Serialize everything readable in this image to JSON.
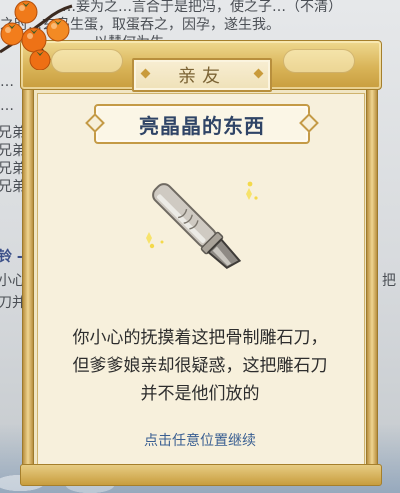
{
  "background": {
    "lines": [
      "…妾为之…言合于是把冯，使之子…（不清）",
      "之时…玄鸟生蛋，取蛋吞之，因孕，遂生我。",
      "…以慧何为生",
      "…",
      "…",
      "兄弟",
      "兄弟",
      "兄弟",
      "兄弟",
      "铃 -",
      "小心",
      "刀并"
    ],
    "right_fragment": "把"
  },
  "modal": {
    "title": "亲友",
    "item_name": "亮晶晶的东西",
    "description_lines": [
      "你小心的抚摸着这把骨制雕石刀，",
      "但爹爹娘亲却很疑惑，这把雕石刀",
      "并不是他们放的"
    ],
    "continue_hint": "点击任意位置继续"
  },
  "colors": {
    "frame_gold": "#c99b3b",
    "paper": "#f7f0dc",
    "name_blue": "#2f4466",
    "hint_blue": "#3a5f92",
    "persimmon": "#f07a1a"
  },
  "icons": {
    "item": "bone-carving-knife-icon",
    "ornament": "persimmon-branch-icon"
  }
}
